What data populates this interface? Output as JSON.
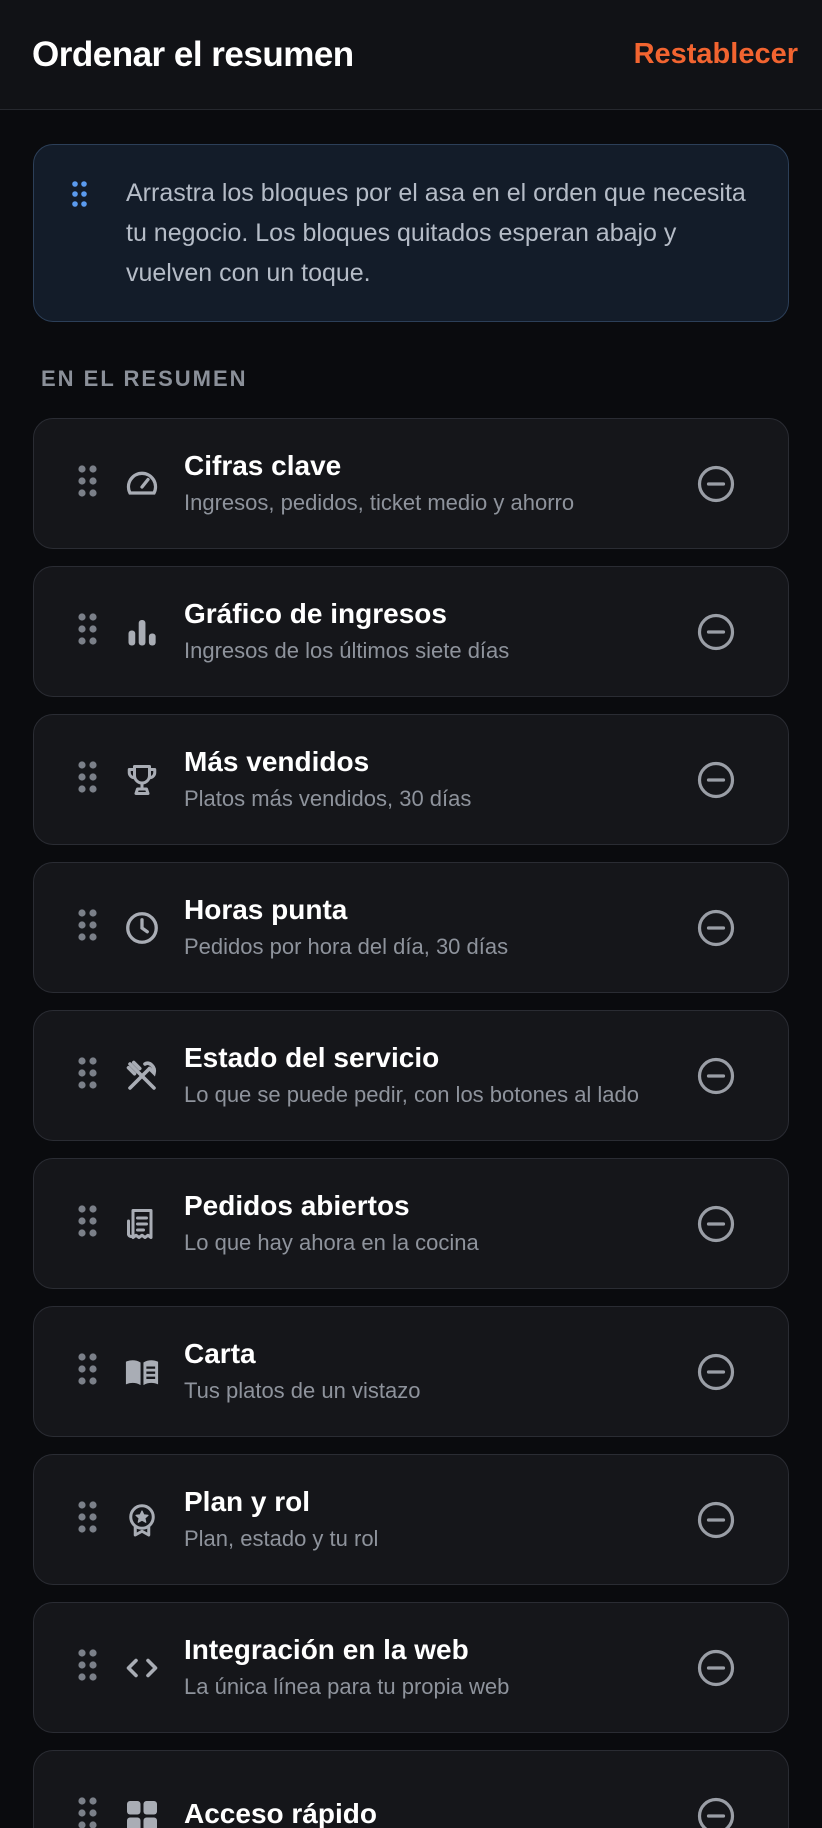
{
  "header": {
    "title": "Ordenar el resumen",
    "reset_label": "Restablecer"
  },
  "info": {
    "text": "Arrastra los bloques por el asa en el orden que necesita tu negocio. Los bloques quitados esperan abajo y vuelven con un toque."
  },
  "section": {
    "label": "EN EL RESUMEN"
  },
  "items": [
    {
      "title": "Cifras clave",
      "subtitle": "Ingresos, pedidos, ticket medio y ahorro",
      "icon": "gauge-icon"
    },
    {
      "title": "Gráfico de ingresos",
      "subtitle": "Ingresos de los últimos siete días",
      "icon": "bar-chart-icon"
    },
    {
      "title": "Más vendidos",
      "subtitle": "Platos más vendidos, 30 días",
      "icon": "trophy-icon"
    },
    {
      "title": "Horas punta",
      "subtitle": "Pedidos por hora del día, 30 días",
      "icon": "clock-icon"
    },
    {
      "title": "Estado del servicio",
      "subtitle": "Lo que se puede pedir, con los botones al lado",
      "icon": "utensils-icon"
    },
    {
      "title": "Pedidos abiertos",
      "subtitle": "Lo que hay ahora en la cocina",
      "icon": "receipt-icon"
    },
    {
      "title": "Carta",
      "subtitle": "Tus platos de un vistazo",
      "icon": "book-icon"
    },
    {
      "title": "Plan y rol",
      "subtitle": "Plan, estado y tu rol",
      "icon": "badge-icon"
    },
    {
      "title": "Integración en la web",
      "subtitle": "La única línea para tu propia web",
      "icon": "code-icon"
    },
    {
      "title": "Acceso rápido",
      "subtitle": "",
      "icon": "grid-icon"
    }
  ],
  "colors": {
    "accent": "#f26430",
    "info_dots": "#5b9bf0",
    "icon_gray": "#a9adb5"
  }
}
